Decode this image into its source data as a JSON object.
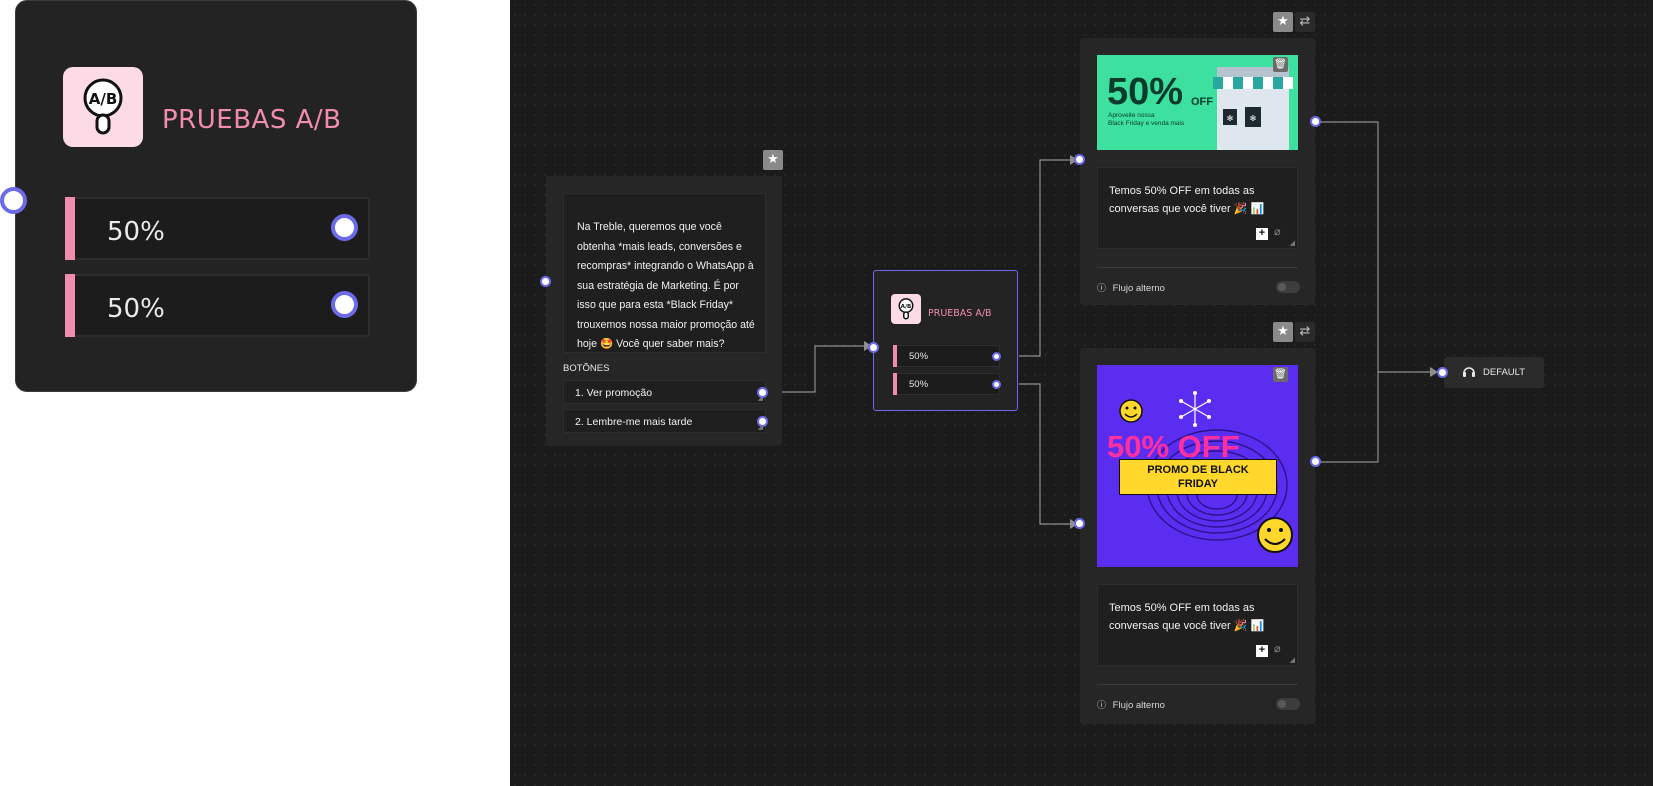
{
  "zoom_node": {
    "title": "PRUEBAS A/B",
    "icon": "ab-test-magnifier-icon",
    "splits": [
      "50%",
      "50%"
    ]
  },
  "message_node": {
    "text": "Na Treble, queremos que você obtenha *mais leads, conversões e recompras* integrando o WhatsApp à sua estratégia de Marketing. É por isso que para esta *Black Friday* trouxemos nossa maior promoção até hoje 🤩 Você quer saber mais?",
    "buttons_label": "BOTÕNES",
    "buttons": [
      "1.  Ver promoção",
      "2.  Lembre-me mais tarde"
    ]
  },
  "ab_node": {
    "title": "PRUEBAS A/B",
    "splits": [
      "50%",
      "50%"
    ]
  },
  "media_top": {
    "image": {
      "headline": "50%",
      "suffix": "OFF",
      "sub1": "Aproveite nossa",
      "sub2": "Black Friday e venda mais"
    },
    "caption": "Temos 50% OFF em todas as conversas que você tiver 🎉 📊",
    "alt_flow": "Flujo alterno"
  },
  "media_bottom": {
    "image": {
      "headline": "50% OFF",
      "banner_line1": "PROMO DE BLACK",
      "banner_line2": "FRIDAY"
    },
    "caption": "Temos 50% OFF em todas as conversas que você tiver 🎉 📊",
    "alt_flow": "Flujo alterno"
  },
  "default_node": {
    "label": "DEFAULT",
    "icon": "headset-icon"
  },
  "colors": {
    "accent_pink": "#f28cae",
    "port_blue": "#6b6bea",
    "canvas_bg": "#1b1b1b",
    "node_bg": "#262626",
    "promo_green": "#3ee0a0",
    "promo_purple": "#5b2df0",
    "promo_yellow": "#ffd82b"
  }
}
